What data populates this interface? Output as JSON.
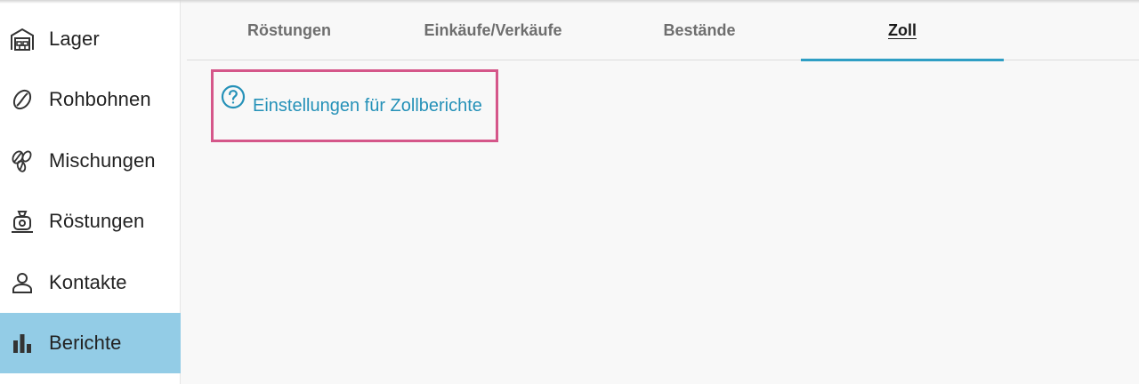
{
  "sidebar": {
    "items": [
      {
        "label": "Lager",
        "icon": "warehouse-icon",
        "active": false
      },
      {
        "label": "Rohbohnen",
        "icon": "coffee-bean-icon",
        "active": false
      },
      {
        "label": "Mischungen",
        "icon": "beans-blend-icon",
        "active": false
      },
      {
        "label": "Röstungen",
        "icon": "roaster-icon",
        "active": false
      },
      {
        "label": "Kontakte",
        "icon": "person-icon",
        "active": false
      },
      {
        "label": "Berichte",
        "icon": "bar-chart-icon",
        "active": true
      }
    ]
  },
  "tabs": [
    {
      "label": "Röstungen",
      "active": false
    },
    {
      "label": "Einkäufe/Verkäufe",
      "active": false
    },
    {
      "label": "Bestände",
      "active": false
    },
    {
      "label": "Zoll",
      "active": true
    }
  ],
  "content": {
    "help_link_label": "Einstellungen für Zollberichte",
    "help_icon": "help-circle-icon"
  },
  "colors": {
    "active_nav_bg": "#93cce6",
    "accent": "#2e9ec4",
    "link": "#2591b8",
    "callout_border": "#d5578a"
  }
}
